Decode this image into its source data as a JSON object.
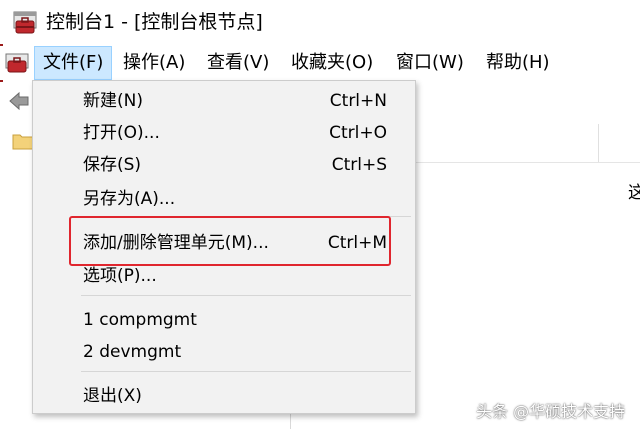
{
  "window": {
    "title": "控制台1 - [控制台根节点]"
  },
  "menubar": {
    "items": [
      {
        "label": "文件(F)"
      },
      {
        "label": "操作(A)"
      },
      {
        "label": "查看(V)"
      },
      {
        "label": "收藏夹(O)"
      },
      {
        "label": "窗口(W)"
      },
      {
        "label": "帮助(H)"
      }
    ]
  },
  "file_menu": {
    "items": [
      {
        "label": "新建(N)",
        "shortcut": "Ctrl+N"
      },
      {
        "label": "打开(O)...",
        "shortcut": "Ctrl+O"
      },
      {
        "label": "保存(S)",
        "shortcut": "Ctrl+S"
      },
      {
        "label": "另存为(A)...",
        "shortcut": ""
      },
      {
        "label": "添加/删除管理单元(M)...",
        "shortcut": "Ctrl+M"
      },
      {
        "label": "选项(P)...",
        "shortcut": ""
      },
      {
        "label": "1 compmgmt",
        "shortcut": ""
      },
      {
        "label": "2 devmgmt",
        "shortcut": ""
      },
      {
        "label": "退出(X)",
        "shortcut": ""
      }
    ]
  },
  "right_pane": {
    "partial_text": "这"
  },
  "watermark": {
    "text": "头条 @华硕技术支持"
  },
  "colors": {
    "highlight": "#e0262e",
    "menu_active": "#cce8ff",
    "menu_bg": "#f2f2f2"
  }
}
